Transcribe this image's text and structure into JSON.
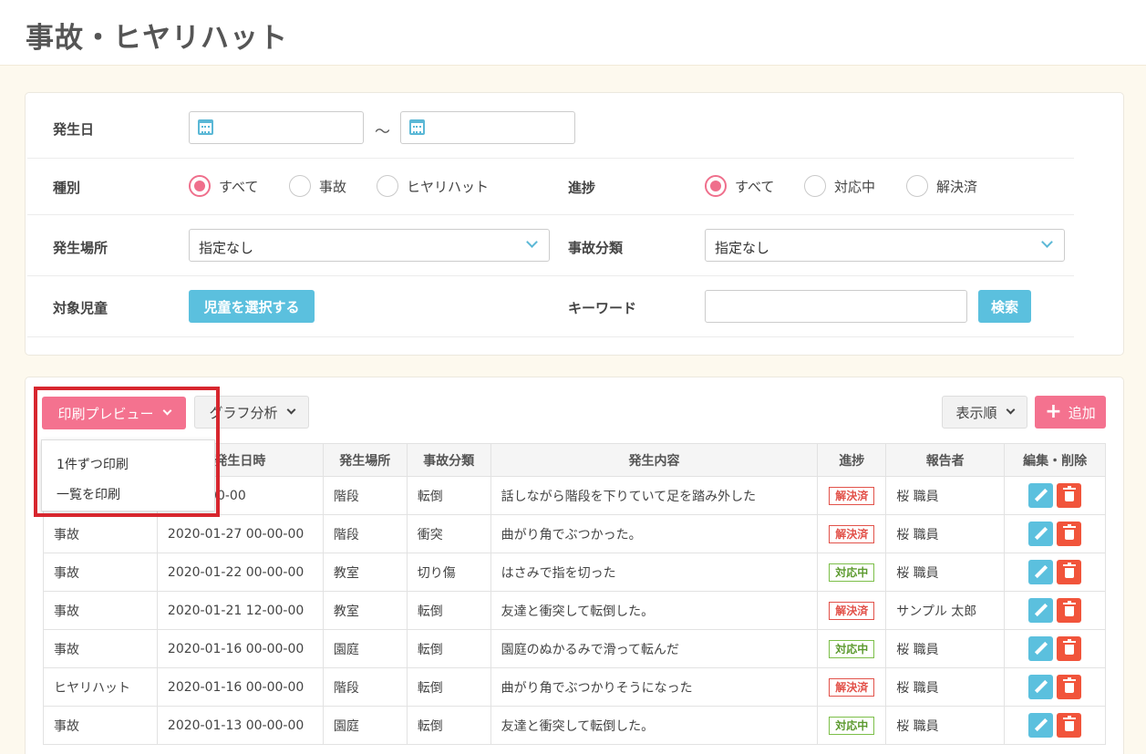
{
  "page_title": "事故・ヒヤリハット",
  "filters": {
    "date_label": "発生日",
    "date_sep": "～",
    "type_label": "種別",
    "type_options": [
      "すべて",
      "事故",
      "ヒヤリハット"
    ],
    "type_selected": "すべて",
    "progress_label": "進捗",
    "progress_options": [
      "すべて",
      "対応中",
      "解決済"
    ],
    "progress_selected": "すべて",
    "place_label": "発生場所",
    "place_value": "指定なし",
    "category_label": "事故分類",
    "category_value": "指定なし",
    "child_label": "対象児童",
    "child_button": "児童を選択する",
    "keyword_label": "キーワード",
    "search_button": "検索"
  },
  "toolbar": {
    "print_preview": "印刷プレビュー",
    "graph": "グラフ分析",
    "sort": "表示順",
    "add": "追加"
  },
  "print_menu": [
    "1件ずつ印刷",
    "一覧を印刷"
  ],
  "table": {
    "headers": [
      "",
      "発生日時",
      "発生場所",
      "事故分類",
      "発生内容",
      "進捗",
      "報告者",
      "編集・削除"
    ],
    "rows": [
      {
        "type": "",
        "datetime": "03 00-00-00",
        "place": "階段",
        "category": "転倒",
        "content": "話しながら階段を下りていて足を踏み外した",
        "status": "解決済",
        "reporter": "桜 職員"
      },
      {
        "type": "事故",
        "datetime": "2020-01-27 00-00-00",
        "place": "階段",
        "category": "衝突",
        "content": "曲がり角でぶつかった。",
        "status": "解決済",
        "reporter": "桜 職員"
      },
      {
        "type": "事故",
        "datetime": "2020-01-22 00-00-00",
        "place": "教室",
        "category": "切り傷",
        "content": "はさみで指を切った",
        "status": "対応中",
        "reporter": "桜 職員"
      },
      {
        "type": "事故",
        "datetime": "2020-01-21 12-00-00",
        "place": "教室",
        "category": "転倒",
        "content": "友達と衝突して転倒した。",
        "status": "解決済",
        "reporter": "サンプル 太郎"
      },
      {
        "type": "事故",
        "datetime": "2020-01-16 00-00-00",
        "place": "園庭",
        "category": "転倒",
        "content": "園庭のぬかるみで滑って転んだ",
        "status": "対応中",
        "reporter": "桜 職員"
      },
      {
        "type": "ヒヤリハット",
        "datetime": "2020-01-16 00-00-00",
        "place": "階段",
        "category": "転倒",
        "content": "曲がり角でぶつかりそうになった",
        "status": "解決済",
        "reporter": "桜 職員"
      },
      {
        "type": "事故",
        "datetime": "2020-01-13 00-00-00",
        "place": "園庭",
        "category": "転倒",
        "content": "友達と衝突して転倒した。",
        "status": "対応中",
        "reporter": "桜 職員"
      }
    ]
  },
  "colors": {
    "pink": "#f4728f",
    "blue": "#5bc0de",
    "red_delete": "#f1543b",
    "highlight": "#d7262e"
  }
}
